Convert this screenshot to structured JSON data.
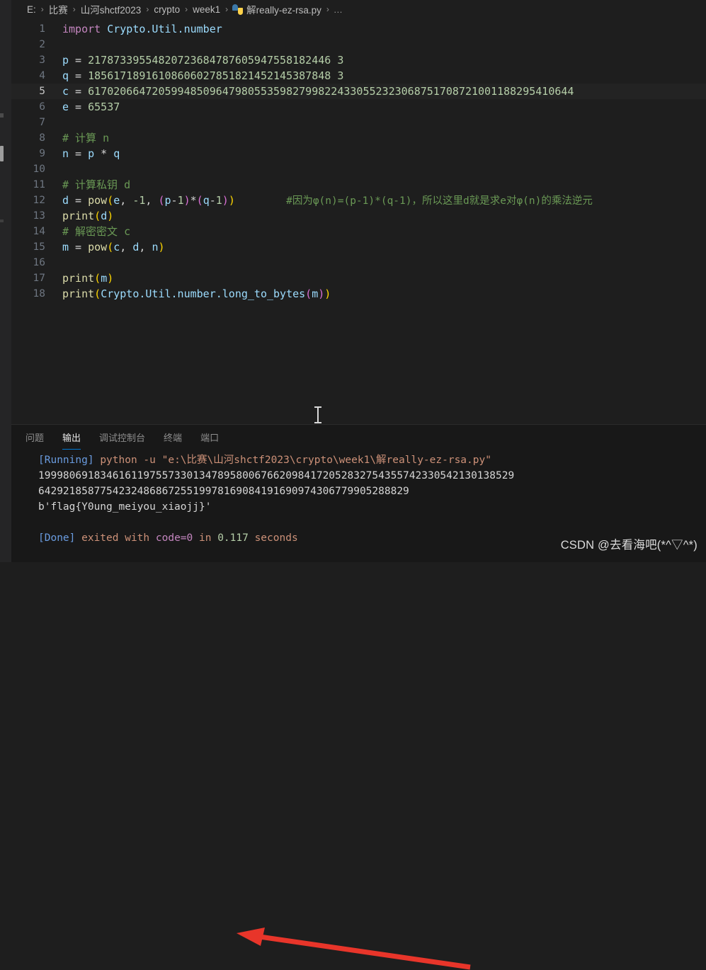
{
  "breadcrumb": {
    "separator": "›",
    "items": [
      "E:",
      "比赛",
      "山河shctf2023",
      "crypto",
      "week1"
    ],
    "file_name": "解really-ez-rsa.py",
    "trailing": "…",
    "file_icon": "python-file-icon"
  },
  "editor": {
    "active_line": 5,
    "lines": [
      {
        "no": "1",
        "segments": [
          {
            "t": "kw",
            "v": "import"
          },
          {
            "t": "plain",
            "v": " "
          },
          {
            "t": "mod",
            "v": "Crypto.Util.number"
          }
        ]
      },
      {
        "no": "2",
        "segments": []
      },
      {
        "no": "3",
        "segments": [
          {
            "t": "var",
            "v": "p"
          },
          {
            "t": "op",
            "v": " = "
          },
          {
            "t": "num",
            "v": "21787339554820723684787605947558182446 3"
          }
        ]
      },
      {
        "no": "4",
        "segments": [
          {
            "t": "var",
            "v": "q"
          },
          {
            "t": "op",
            "v": " = "
          },
          {
            "t": "num",
            "v": "18561718916108606027851821452145387848 3"
          }
        ]
      },
      {
        "no": "5",
        "segments": [
          {
            "t": "var",
            "v": "c"
          },
          {
            "t": "op",
            "v": " = "
          },
          {
            "t": "num",
            "v": "6170206647205994850964798055359827998224330552323068751708721001188295410644"
          }
        ]
      },
      {
        "no": "6",
        "segments": [
          {
            "t": "var",
            "v": "e"
          },
          {
            "t": "op",
            "v": " = "
          },
          {
            "t": "num",
            "v": "65537"
          }
        ]
      },
      {
        "no": "7",
        "segments": []
      },
      {
        "no": "8",
        "segments": [
          {
            "t": "comment",
            "v": "# 计算 n"
          }
        ]
      },
      {
        "no": "9",
        "segments": [
          {
            "t": "var",
            "v": "n"
          },
          {
            "t": "op",
            "v": " = "
          },
          {
            "t": "var",
            "v": "p"
          },
          {
            "t": "op",
            "v": " * "
          },
          {
            "t": "var",
            "v": "q"
          }
        ]
      },
      {
        "no": "10",
        "segments": []
      },
      {
        "no": "11",
        "segments": [
          {
            "t": "comment",
            "v": "# 计算私钥 d"
          }
        ]
      },
      {
        "no": "12",
        "segments": [
          {
            "t": "var",
            "v": "d"
          },
          {
            "t": "op",
            "v": " = "
          },
          {
            "t": "fn",
            "v": "pow"
          },
          {
            "t": "paren1",
            "v": "("
          },
          {
            "t": "var",
            "v": "e"
          },
          {
            "t": "op",
            "v": ", "
          },
          {
            "t": "num",
            "v": "-1"
          },
          {
            "t": "op",
            "v": ", "
          },
          {
            "t": "paren2",
            "v": "("
          },
          {
            "t": "var",
            "v": "p"
          },
          {
            "t": "op",
            "v": "-"
          },
          {
            "t": "num",
            "v": "1"
          },
          {
            "t": "paren2",
            "v": ")"
          },
          {
            "t": "op",
            "v": "*"
          },
          {
            "t": "paren2",
            "v": "("
          },
          {
            "t": "var",
            "v": "q"
          },
          {
            "t": "op",
            "v": "-"
          },
          {
            "t": "num",
            "v": "1"
          },
          {
            "t": "paren2",
            "v": ")"
          },
          {
            "t": "paren1",
            "v": ")"
          }
        ]
      },
      {
        "no": "13",
        "segments": [
          {
            "t": "fn",
            "v": "print"
          },
          {
            "t": "paren1",
            "v": "("
          },
          {
            "t": "var",
            "v": "d"
          },
          {
            "t": "paren1",
            "v": ")"
          }
        ]
      },
      {
        "no": "14",
        "segments": [
          {
            "t": "comment",
            "v": "# 解密密文 c"
          }
        ]
      },
      {
        "no": "15",
        "segments": [
          {
            "t": "var",
            "v": "m"
          },
          {
            "t": "op",
            "v": " = "
          },
          {
            "t": "fn",
            "v": "pow"
          },
          {
            "t": "paren1",
            "v": "("
          },
          {
            "t": "var",
            "v": "c"
          },
          {
            "t": "op",
            "v": ", "
          },
          {
            "t": "var",
            "v": "d"
          },
          {
            "t": "op",
            "v": ", "
          },
          {
            "t": "var",
            "v": "n"
          },
          {
            "t": "paren1",
            "v": ")"
          }
        ]
      },
      {
        "no": "16",
        "segments": []
      },
      {
        "no": "17",
        "segments": [
          {
            "t": "fn",
            "v": "print"
          },
          {
            "t": "paren1",
            "v": "("
          },
          {
            "t": "var",
            "v": "m"
          },
          {
            "t": "paren1",
            "v": ")"
          }
        ]
      },
      {
        "no": "18",
        "segments": [
          {
            "t": "fn",
            "v": "print"
          },
          {
            "t": "paren1",
            "v": "("
          },
          {
            "t": "mod",
            "v": "Crypto.Util.number.long_to_bytes"
          },
          {
            "t": "paren2",
            "v": "("
          },
          {
            "t": "var",
            "v": "m"
          },
          {
            "t": "paren2",
            "v": ")"
          },
          {
            "t": "paren1",
            "v": ")"
          }
        ]
      }
    ],
    "inline_comment": {
      "line": 12,
      "text": "#因为φ(n)=(p-1)*(q-1)，所以这里d就是求e对φ(n)的乘法逆元"
    }
  },
  "panel": {
    "tabs": [
      {
        "label": "问题",
        "active": false
      },
      {
        "label": "输出",
        "active": true
      },
      {
        "label": "调试控制台",
        "active": false
      },
      {
        "label": "终端",
        "active": false
      },
      {
        "label": "端口",
        "active": false
      }
    ],
    "output": [
      {
        "parts": [
          {
            "c": "blue",
            "v": "[Running] "
          },
          {
            "c": "orange",
            "v": "python -u \"e:\\比赛\\山河shctf2023\\crypto\\week1\\解really-ez-rsa.py\""
          }
        ]
      },
      {
        "parts": [
          {
            "c": "white",
            "v": "19998069183461611975573301347895800676620984172052832754355742330542130138529"
          }
        ]
      },
      {
        "parts": [
          {
            "c": "white",
            "v": "642921858775423248686725519978169084191690974306779905288829"
          }
        ]
      },
      {
        "parts": [
          {
            "c": "white",
            "v": "b'flag{Y0ung_meiyou_xiaojj}'"
          }
        ]
      },
      {
        "parts": []
      },
      {
        "parts": [
          {
            "c": "blue",
            "v": "[Done] "
          },
          {
            "c": "orange",
            "v": "exited with "
          },
          {
            "c": "magenta",
            "v": "code=0"
          },
          {
            "c": "orange",
            "v": " in "
          },
          {
            "c": "green",
            "v": "0.117"
          },
          {
            "c": "orange",
            "v": " seconds"
          }
        ]
      }
    ]
  },
  "annotation": {
    "arrow_color": "#e8352a",
    "arrow_name": "red-pointer-arrow"
  },
  "watermark": {
    "text": "CSDN @去看海吧(*^▽^*)"
  },
  "colors": {
    "editor_bg": "#1e1e1e",
    "panel_bg": "#181818",
    "accent": "#0078d4",
    "comment": "#6a9955",
    "number": "#b5cea8",
    "keyword": "#c586c0"
  }
}
